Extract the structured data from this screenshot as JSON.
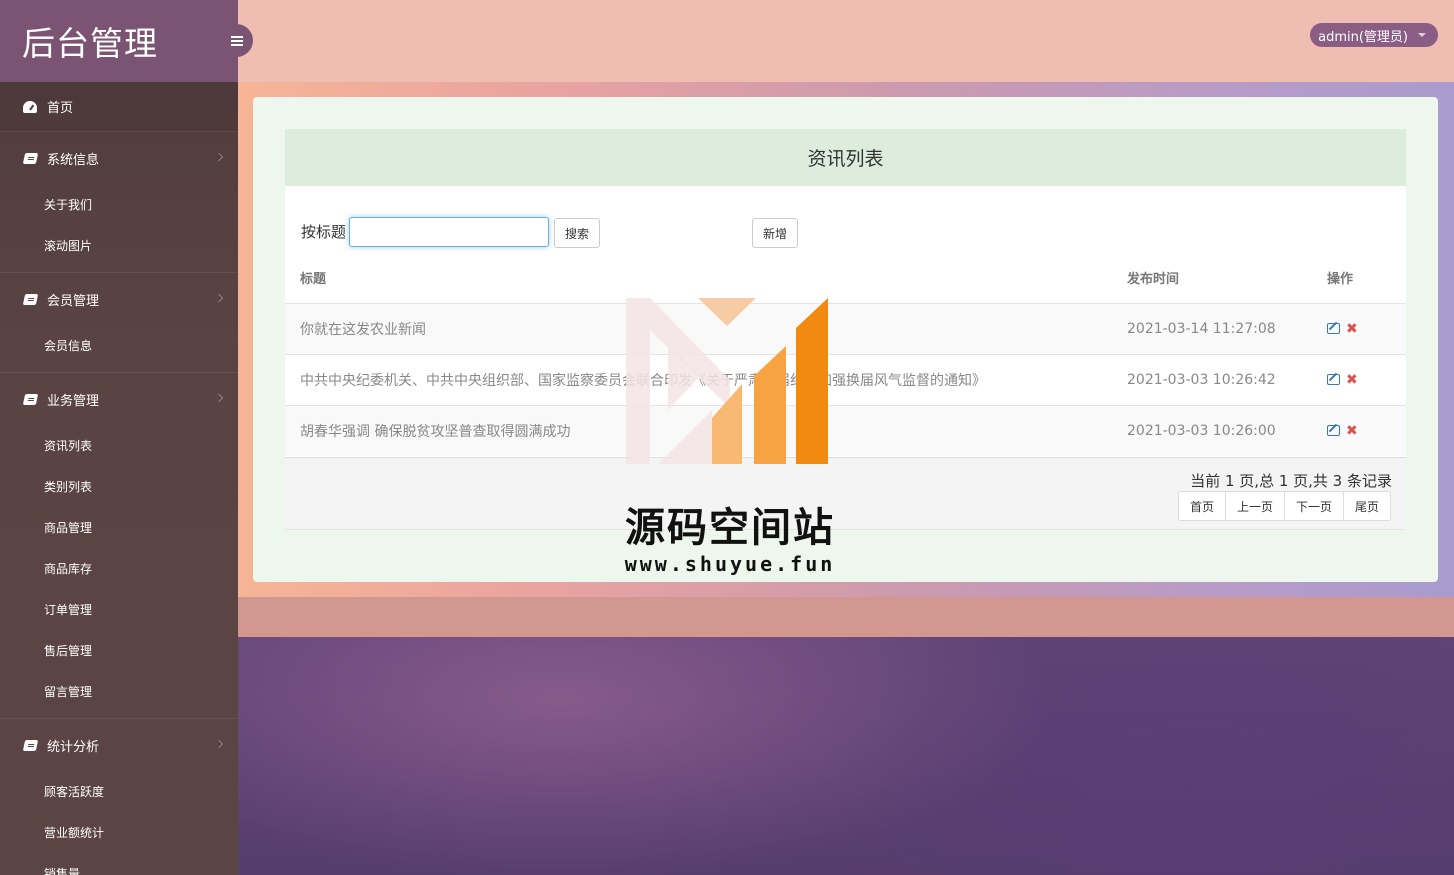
{
  "sidebar": {
    "brand": "后台管理",
    "home": "首页",
    "groups": [
      {
        "label": "系统信息",
        "items": [
          "关于我们",
          "滚动图片"
        ]
      },
      {
        "label": "会员管理",
        "items": [
          "会员信息"
        ]
      },
      {
        "label": "业务管理",
        "items": [
          "资讯列表",
          "类别列表",
          "商品管理",
          "商品库存",
          "订单管理",
          "售后管理",
          "留言管理"
        ]
      },
      {
        "label": "统计分析",
        "items": [
          "顾客活跃度",
          "营业额统计",
          "销售量"
        ]
      }
    ]
  },
  "topbar": {
    "user": "admin(管理员)"
  },
  "panel": {
    "title": "资讯列表",
    "search_label": "按标题",
    "search_value": "",
    "search_button": "搜索",
    "add_button": "新增",
    "columns": [
      "标题",
      "发布时间",
      "操作"
    ],
    "rows": [
      {
        "title": "你就在这发农业新闻",
        "time": "2021-03-14 11:27:08"
      },
      {
        "title": "中共中央纪委机关、中共中央组织部、国家监察委员会联合印发《关于严肃换届纪律加强换届风气监督的通知》",
        "time": "2021-03-03 10:26:42"
      },
      {
        "title": "胡春华强调 确保脱贫攻坚普查取得圆满成功",
        "time": "2021-03-03 10:26:00"
      }
    ],
    "pager_info": "当前 1 页,总 1 页,共 3 条记录",
    "pager_buttons": [
      "首页",
      "上一页",
      "下一页",
      "尾页"
    ]
  },
  "watermark": {
    "name": "源码空间站",
    "url": "www.shuyue.fun"
  },
  "colors": {
    "sidebar": "#5a4444",
    "brand_bg": "#7b5473",
    "topbar": "#f0bdb3",
    "panel_head": "#dcecdd",
    "edit_icon": "#337ab7",
    "delete_icon": "#d9534f"
  }
}
